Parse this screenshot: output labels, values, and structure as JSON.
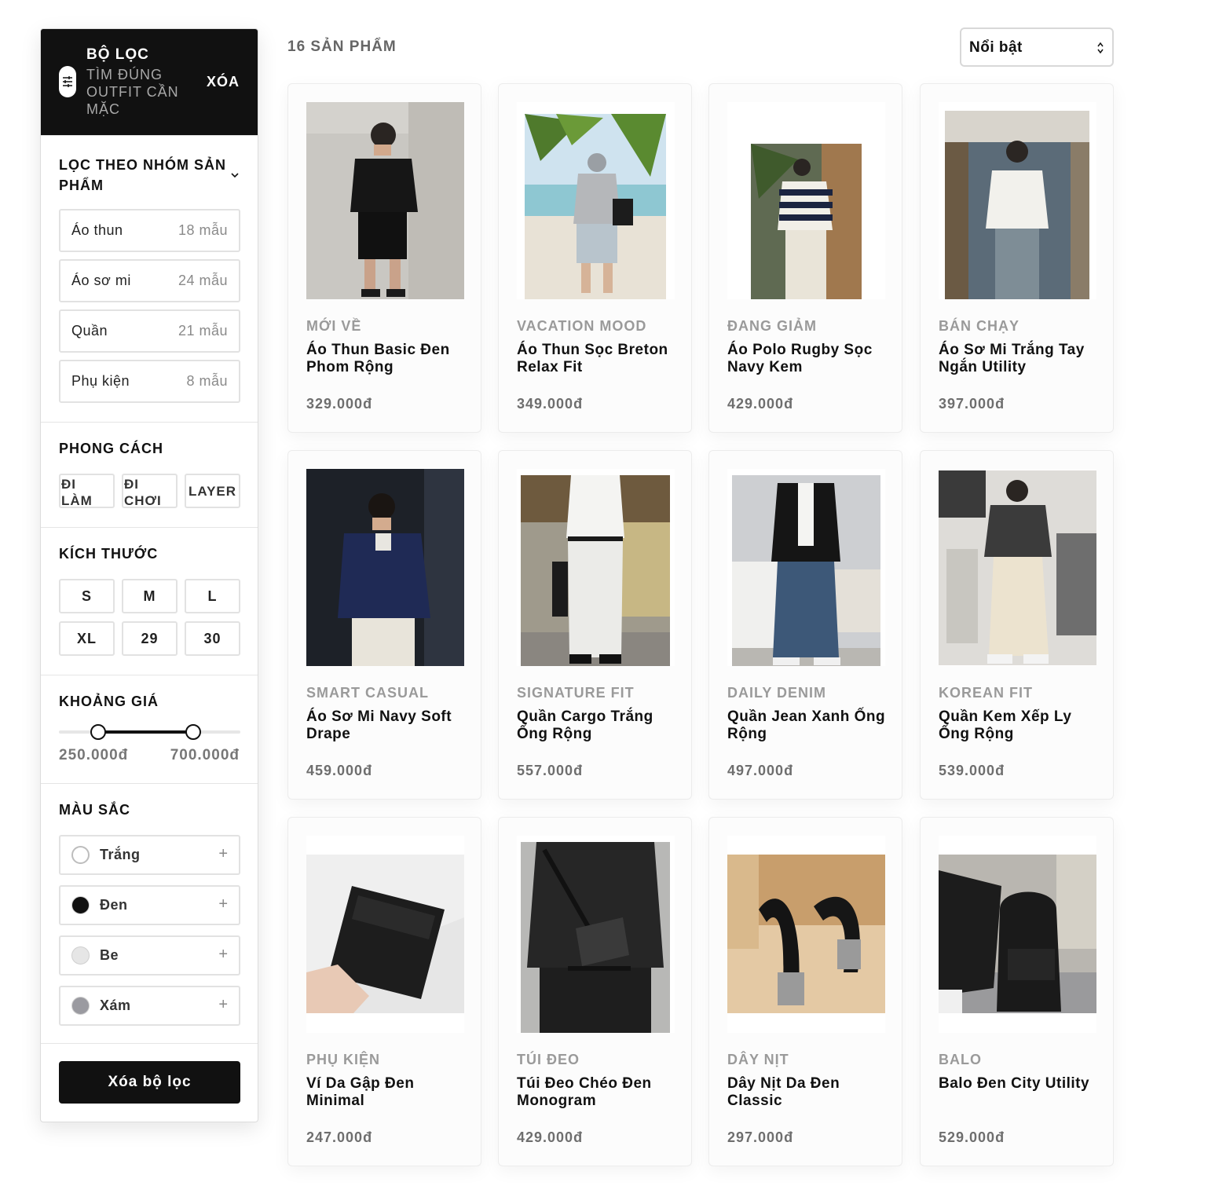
{
  "sidebar": {
    "title": "BỘ LỌC",
    "subtitle": "TÌM ĐÚNG OUTFIT CẦN MẶC",
    "clear_label": "XÓA",
    "category_section": {
      "title": "LỌC THEO NHÓM SẢN PHẨM",
      "items": [
        {
          "label": "Áo thun",
          "count": "18 mẫu"
        },
        {
          "label": "Áo sơ mi",
          "count": "24 mẫu"
        },
        {
          "label": "Quần",
          "count": "21 mẫu"
        },
        {
          "label": "Phụ kiện",
          "count": "8 mẫu"
        }
      ]
    },
    "style_section": {
      "title": "PHONG CÁCH",
      "chips": [
        "ĐI LÀM",
        "ĐI CHƠI",
        "LAYER"
      ]
    },
    "size_section": {
      "title": "KÍCH THƯỚC",
      "sizes": [
        "S",
        "M",
        "L",
        "XL",
        "29",
        "30"
      ]
    },
    "price_section": {
      "title": "KHOẢNG GIÁ",
      "min_label": "250.000đ",
      "max_label": "700.000đ",
      "range_fraction": [
        0.215,
        0.74
      ]
    },
    "color_section": {
      "title": "MÀU SẮC",
      "items": [
        {
          "label": "Trắng",
          "swatch": "#ffffff"
        },
        {
          "label": "Đen",
          "swatch": "#111111"
        },
        {
          "label": "Be",
          "swatch": "#e6e6e6"
        },
        {
          "label": "Xám",
          "swatch": "#9a9aa0"
        }
      ]
    },
    "clear_button": "Xóa bộ lọc"
  },
  "toolbar": {
    "product_count": "16 SẢN PHẨM",
    "sort_value": "Nổi bật"
  },
  "products": [
    {
      "tag": "MỚI VỀ",
      "name": "Áo Thun Basic Đen Phom Rộng",
      "price": "329.000đ"
    },
    {
      "tag": "VACATION MOOD",
      "name": "Áo Thun Sọc Breton Relax Fit",
      "price": "349.000đ"
    },
    {
      "tag": "ĐANG GIẢM",
      "name": "Áo Polo Rugby Sọc Navy Kem",
      "price": "429.000đ"
    },
    {
      "tag": "BÁN CHẠY",
      "name": "Áo Sơ Mi Trắng Tay Ngắn Utility",
      "price": "397.000đ"
    },
    {
      "tag": "SMART CASUAL",
      "name": "Áo Sơ Mi Navy Soft Drape",
      "price": "459.000đ"
    },
    {
      "tag": "SIGNATURE FIT",
      "name": "Quần Cargo Trắng Ống Rộng",
      "price": "557.000đ"
    },
    {
      "tag": "DAILY DENIM",
      "name": "Quần Jean Xanh Ống Rộng",
      "price": "497.000đ"
    },
    {
      "tag": "KOREAN FIT",
      "name": "Quần Kem Xếp Ly Ống Rộng",
      "price": "539.000đ"
    },
    {
      "tag": "PHỤ KIỆN",
      "name": "Ví Da Gập Đen Minimal",
      "price": "247.000đ"
    },
    {
      "tag": "TÚI ĐEO",
      "name": "Túi Đeo Chéo Đen Monogram",
      "price": "429.000đ"
    },
    {
      "tag": "DÂY NỊT",
      "name": "Dây Nịt Da Đen Classic",
      "price": "297.000đ"
    },
    {
      "tag": "BALO",
      "name": "Balo Đen City Utility",
      "price": "529.000đ"
    }
  ]
}
